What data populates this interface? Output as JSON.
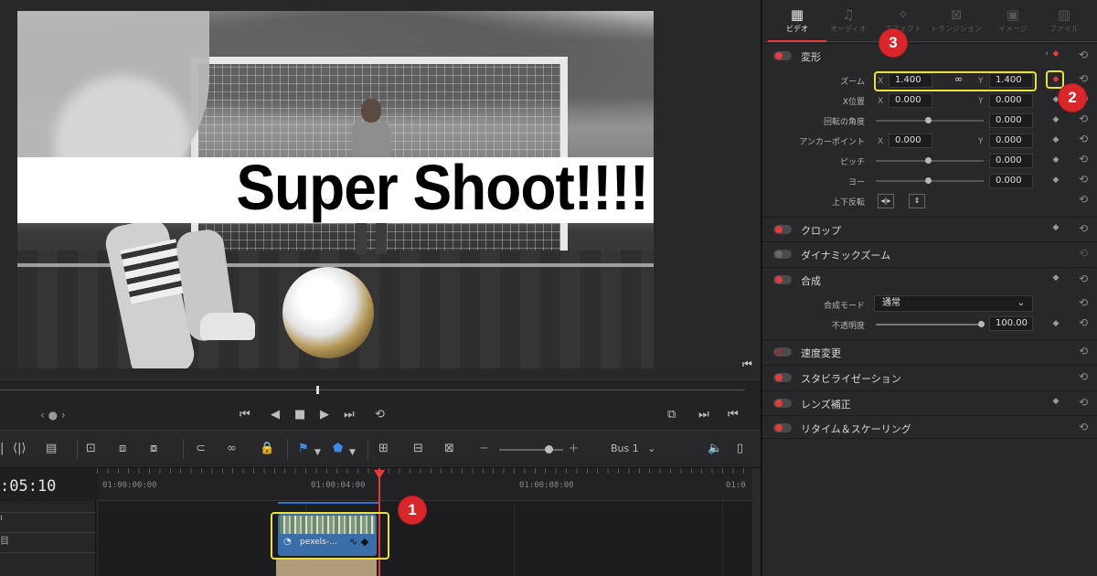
{
  "viewer": {
    "overlay_text": "Super Shoot!!!!"
  },
  "transport": {
    "nav": "‹ ● ›"
  },
  "toolbar": {
    "bus_label": "Bus 1",
    "bus_chevron": "⌄"
  },
  "timeline": {
    "timecode": ":05:10",
    "ruler_labels": [
      "01:00:00:00",
      "01:00:04:00",
      "01:00:08:00",
      "01:0"
    ],
    "clip_name": "pexels-...",
    "track_labels": [
      "ı",
      "目"
    ]
  },
  "inspector": {
    "tabs": [
      {
        "label": "ビデオ",
        "icon": "film-icon",
        "active": true
      },
      {
        "label": "オーディオ",
        "icon": "music-note-icon",
        "active": false
      },
      {
        "label": "エフェクト",
        "icon": "magic-wand-icon",
        "active": false
      },
      {
        "label": "トランジション",
        "icon": "transition-icon",
        "active": false
      },
      {
        "label": "イメージ",
        "icon": "image-icon",
        "active": false
      },
      {
        "label": "ファイル",
        "icon": "file-box-icon",
        "active": false
      }
    ],
    "transform": {
      "title": "変形",
      "zoom_label": "ズーム",
      "zoom_x": "1.400",
      "zoom_y": "1.400",
      "position_label": "X位置",
      "position_x": "0.000",
      "position_y": "0.000",
      "rotation_label": "回転の角度",
      "rotation": "0.000",
      "anchor_label": "アンカーポイント",
      "anchor_x": "0.000",
      "anchor_y": "0.000",
      "pitch_label": "ピッチ",
      "pitch": "0.000",
      "yaw_label": "ヨー",
      "yaw": "0.000",
      "flip_label": "上下反転",
      "axis_x": "X",
      "axis_y": "Y"
    },
    "crop": {
      "title": "クロップ"
    },
    "dynamic_zoom": {
      "title": "ダイナミックズーム"
    },
    "composite": {
      "title": "合成",
      "mode_label": "合成モード",
      "mode_value": "通常",
      "opacity_label": "不透明度",
      "opacity_value": "100.00"
    },
    "speed": {
      "title": "速度変更"
    },
    "stabilization": {
      "title": "スタビライゼーション"
    },
    "lens": {
      "title": "レンズ補正"
    },
    "retime": {
      "title": "リタイム＆スケーリング"
    }
  },
  "annotations": {
    "badge_1": "1",
    "badge_2": "2",
    "badge_3": "3"
  },
  "colors": {
    "accent_red": "#e23c3c",
    "highlight_yellow": "#e8e23a",
    "badge_red": "#d8262b",
    "clip_blue": "#3a6ea8"
  }
}
